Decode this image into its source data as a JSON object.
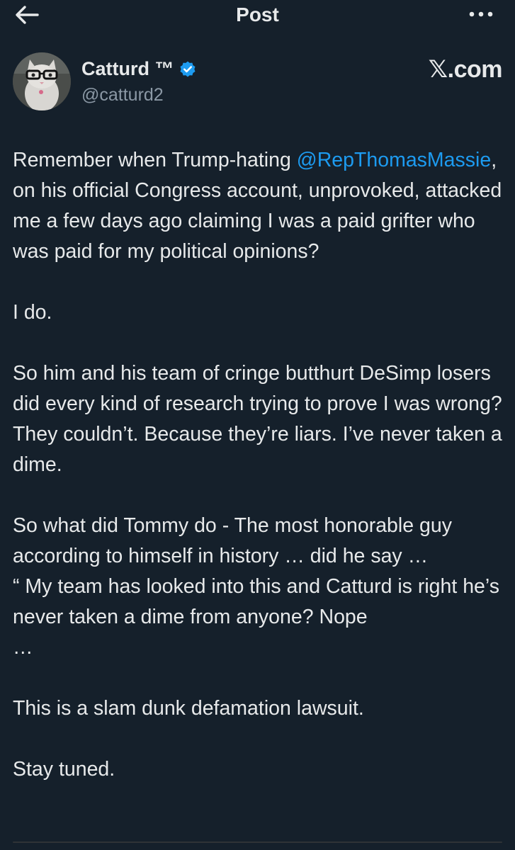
{
  "header": {
    "title": "Post",
    "back_icon": "arrow-left-icon",
    "more_icon": "more-horizontal-icon"
  },
  "author": {
    "name": "Catturd ™",
    "handle": "@catturd2",
    "verified_icon": "verified-badge-icon",
    "verified_color": "#1d9bf0",
    "source_label": "𝕏.com"
  },
  "post": {
    "p1_before": "Remember when Trump-hating ",
    "p1_mention": "@RepThomasMassie",
    "p1_after": ", on his official Congress account, unprovoked, attacked me a few days ago claiming I was a paid grifter who was paid for my political opinions?",
    "p2": "I do.",
    "p3": "So him and his team of cringe butthurt DeSimp losers did every kind of research trying to prove I was wrong? They couldn’t. Because they’re liars. I’ve never taken a dime.",
    "p4_line1": "So what did Tommy do - The most honorable guy according to himself in history … did he say …",
    "p4_line2": "“ My team has looked into this and Catturd is right he’s never taken a dime from anyone? Nope",
    "p4_line3": "…",
    "p5": "This is a slam dunk defamation lawsuit.",
    "p6": "Stay tuned."
  },
  "colors": {
    "background": "#15202b",
    "text": "#e7e9ea",
    "secondary_text": "#8b98a5",
    "link": "#1d9bf0"
  }
}
